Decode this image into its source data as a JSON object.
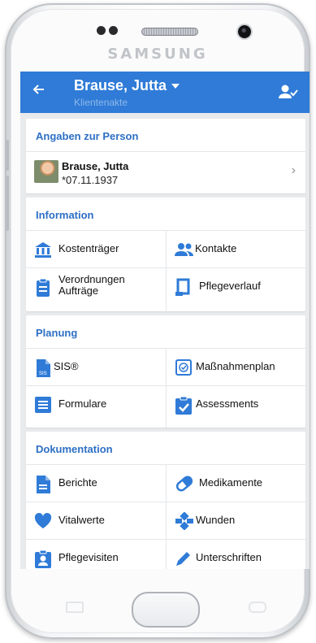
{
  "device": {
    "brand": "SAMSUNG"
  },
  "appbar": {
    "title": "Brause, Jutta",
    "subtitle": "Klientenakte",
    "color": "#2f7bd7",
    "back_icon": "arrow-left-icon",
    "right_icon": "account-check-icon"
  },
  "person": {
    "header": "Angaben zur Person",
    "name": "Brause, Jutta",
    "dob": "*07.11.1937"
  },
  "information": {
    "header": "Information",
    "items": [
      {
        "label": "Kostenträger",
        "icon": "bank-icon"
      },
      {
        "label": "Kontakte",
        "icon": "contacts-icon"
      },
      {
        "label": "Verordnungen\nAufträge",
        "icon": "clipboard-icon"
      },
      {
        "label": "Pflegeverlauf",
        "icon": "pflegeverlauf-icon"
      }
    ]
  },
  "planung": {
    "header": "Planung",
    "items": [
      {
        "label": "SIS®",
        "icon": "sis-document-icon"
      },
      {
        "label": "Maßnahmenplan",
        "icon": "massnahmenplan-icon"
      },
      {
        "label": "Formulare",
        "icon": "form-icon"
      },
      {
        "label": "Assessments",
        "icon": "clipboard-check-icon"
      }
    ]
  },
  "dokumentation": {
    "header": "Dokumentation",
    "items": [
      {
        "label": "Berichte",
        "icon": "document-icon"
      },
      {
        "label": "Medikamente",
        "icon": "pill-icon"
      },
      {
        "label": "Vitalwerte",
        "icon": "heart-icon"
      },
      {
        "label": "Wunden",
        "icon": "bandage-icon"
      },
      {
        "label": "Pflegevisiten",
        "icon": "visit-badge-icon"
      },
      {
        "label": "Unterschriften",
        "icon": "pen-icon"
      }
    ]
  }
}
